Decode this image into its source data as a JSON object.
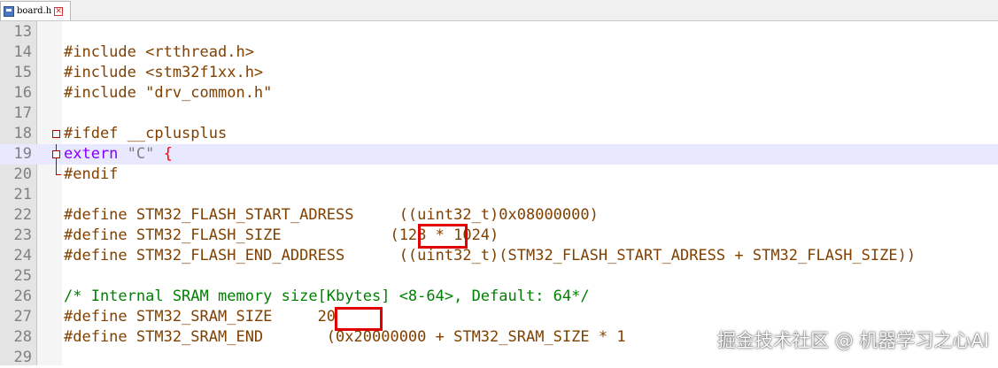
{
  "tab": {
    "label": "board.h"
  },
  "lines": [
    {
      "num": "13",
      "text": ""
    },
    {
      "num": "14",
      "text": "#include <rtthread.h>"
    },
    {
      "num": "15",
      "text": "#include <stm32f1xx.h>"
    },
    {
      "num": "16",
      "text": "#include \"drv_common.h\""
    },
    {
      "num": "17",
      "text": ""
    },
    {
      "num": "18",
      "text": "#ifdef __cplusplus"
    },
    {
      "num": "19",
      "kw": "extern",
      "str": "\"C\"",
      "brace": "{"
    },
    {
      "num": "20",
      "text": "#endif"
    },
    {
      "num": "21",
      "text": ""
    },
    {
      "num": "22",
      "text": "#define STM32_FLASH_START_ADRESS     ((uint32_t)0x08000000)"
    },
    {
      "num": "23",
      "text": "#define STM32_FLASH_SIZE            (128 * 1024)"
    },
    {
      "num": "24",
      "text": "#define STM32_FLASH_END_ADDRESS      ((uint32_t)(STM32_FLASH_START_ADRESS + STM32_FLASH_SIZE))"
    },
    {
      "num": "25",
      "text": ""
    },
    {
      "num": "26",
      "comment": "/* Internal SRAM memory size[Kbytes] <8-64>, Default: 64*/"
    },
    {
      "num": "27",
      "text": "#define STM32_SRAM_SIZE     20"
    },
    {
      "num": "28",
      "text": "#define STM32_SRAM_END       (0x20000000 + STM32_SRAM_SIZE * 1"
    },
    {
      "num": "29",
      "text": ""
    }
  ],
  "watermark": "掘金技术社区 @ 机器学习之心AI"
}
